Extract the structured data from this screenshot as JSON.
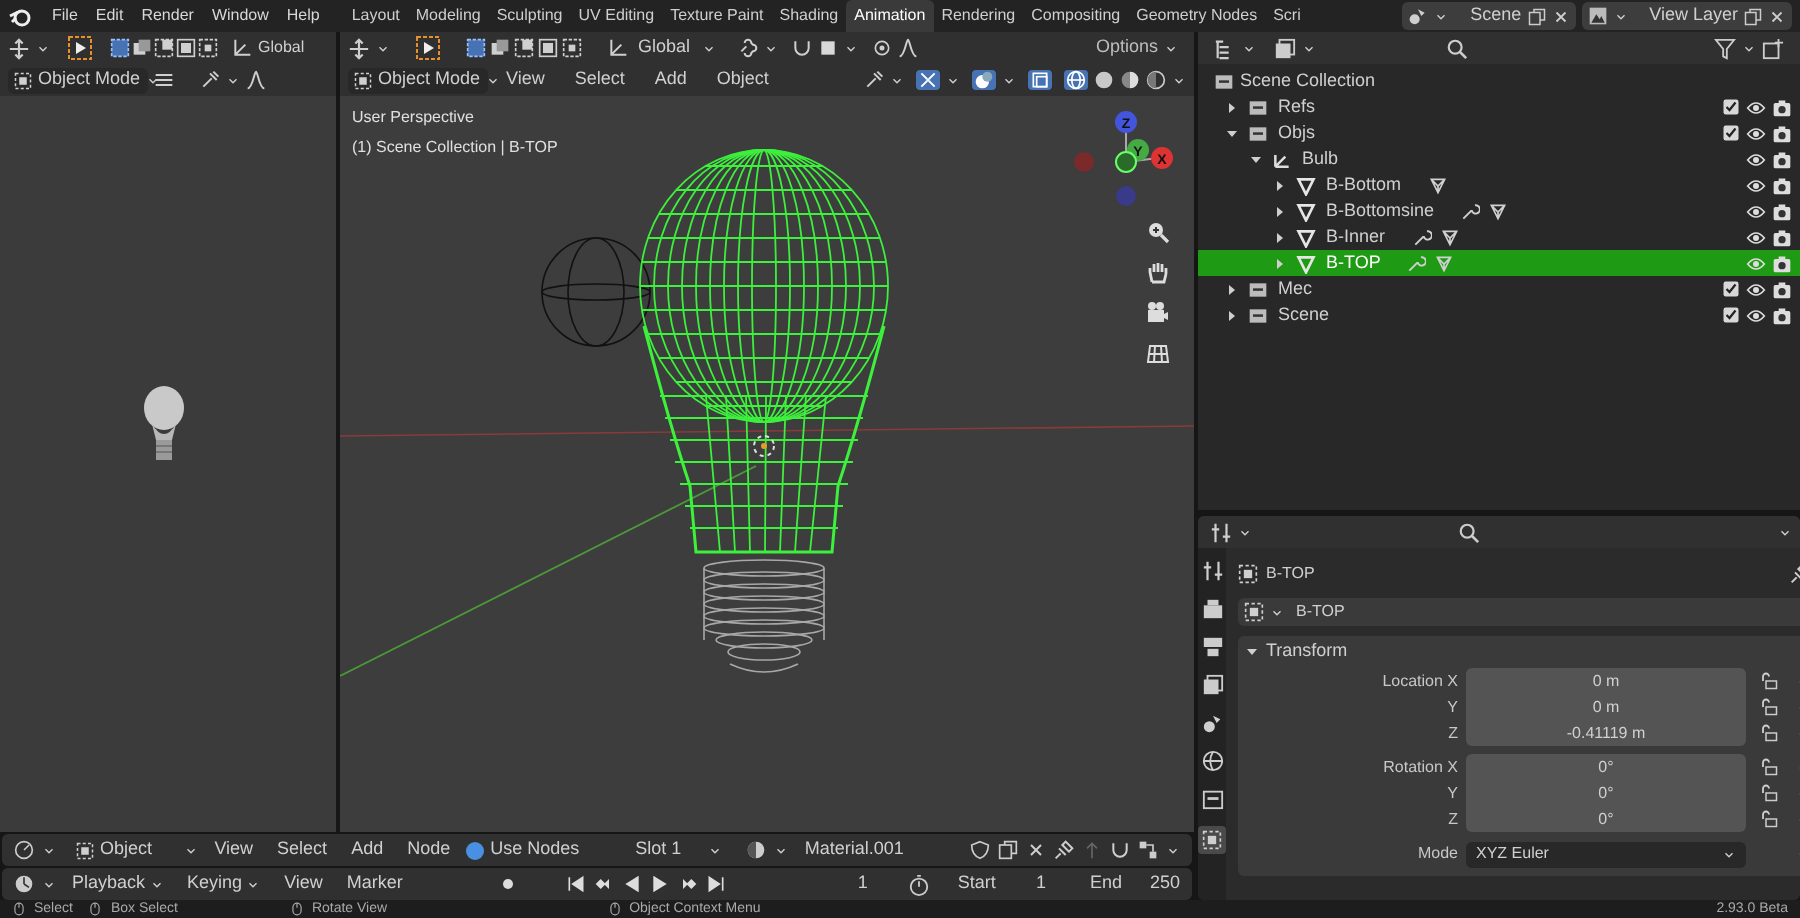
{
  "menu": [
    "File",
    "Edit",
    "Render",
    "Window",
    "Help"
  ],
  "workspace_tabs": [
    {
      "label": "Layout",
      "selected": false
    },
    {
      "label": "Modeling",
      "selected": false
    },
    {
      "label": "Sculpting",
      "selected": false
    },
    {
      "label": "UV Editing",
      "selected": false
    },
    {
      "label": "Texture Paint",
      "selected": false
    },
    {
      "label": "Shading",
      "selected": false
    },
    {
      "label": "Animation",
      "selected": true
    },
    {
      "label": "Rendering",
      "selected": false
    },
    {
      "label": "Compositing",
      "selected": false
    },
    {
      "label": "Geometry Nodes",
      "selected": false
    },
    {
      "label": "Scri",
      "selected": false
    }
  ],
  "scene_field": {
    "value": "Scene"
  },
  "view_layer_field": {
    "value": "View Layer"
  },
  "left_viewport": {
    "orientation": "Global",
    "mode": "Object Mode"
  },
  "viewport": {
    "orientation": "Global",
    "options": "Options",
    "mode": "Object Mode",
    "menus": [
      "View",
      "Select",
      "Add",
      "Object"
    ],
    "overlay_lines": [
      "User Perspective",
      "(1) Scene Collection | B-TOP"
    ],
    "gizmo_axes": [
      "Z",
      "Y",
      "X"
    ]
  },
  "outliner": {
    "root": "Scene Collection",
    "items": [
      {
        "label": "Refs",
        "kind": "collection",
        "expanded": false,
        "selected": false
      },
      {
        "label": "Objs",
        "kind": "collection",
        "expanded": true,
        "selected": false,
        "children": [
          {
            "label": "Bulb",
            "kind": "empty",
            "expanded": true,
            "selected": false,
            "children": [
              {
                "label": "B-Bottom",
                "kind": "mesh",
                "expanded": false,
                "selected": false,
                "has_modifier": false
              },
              {
                "label": "B-Bottomsine",
                "kind": "mesh",
                "expanded": false,
                "selected": false,
                "has_modifier": true
              },
              {
                "label": "B-Inner",
                "kind": "mesh",
                "expanded": false,
                "selected": false,
                "has_modifier": true
              },
              {
                "label": "B-TOP",
                "kind": "mesh",
                "expanded": false,
                "selected": true,
                "has_modifier": true
              }
            ]
          }
        ]
      },
      {
        "label": "Mec",
        "kind": "collection",
        "expanded": false,
        "selected": false
      },
      {
        "label": "Scene",
        "kind": "collection",
        "expanded": false,
        "selected": false
      }
    ]
  },
  "properties": {
    "object_name": "B-TOP",
    "data_name": "B-TOP",
    "panel": {
      "title": "Transform",
      "expanded": true
    },
    "rows": [
      {
        "label": "Location X",
        "value": "0 m"
      },
      {
        "label": "Y",
        "value": "0 m"
      },
      {
        "label": "Z",
        "value": "-0.41119 m"
      },
      {
        "label": "Rotation X",
        "value": "0°"
      },
      {
        "label": "Y",
        "value": "0°"
      },
      {
        "label": "Z",
        "value": "0°"
      }
    ],
    "mode": {
      "label": "Mode",
      "value": "XYZ Euler"
    }
  },
  "shader_header": {
    "mode": "Object",
    "menus": [
      "View",
      "Select",
      "Add",
      "Node"
    ],
    "use_nodes": {
      "label": "Use Nodes",
      "checked": true
    },
    "slot": "Slot 1",
    "material": "Material.001"
  },
  "timeline": {
    "menus": [
      "Playback",
      "Keying",
      "View",
      "Marker"
    ],
    "current_frame": "1",
    "start_label": "Start",
    "start": "1",
    "end_label": "End",
    "end": "250"
  },
  "status_bar": {
    "items": [
      "Select",
      "Box Select",
      "Rotate View",
      "Object Context Menu"
    ],
    "version": "2.93.0 Beta"
  }
}
